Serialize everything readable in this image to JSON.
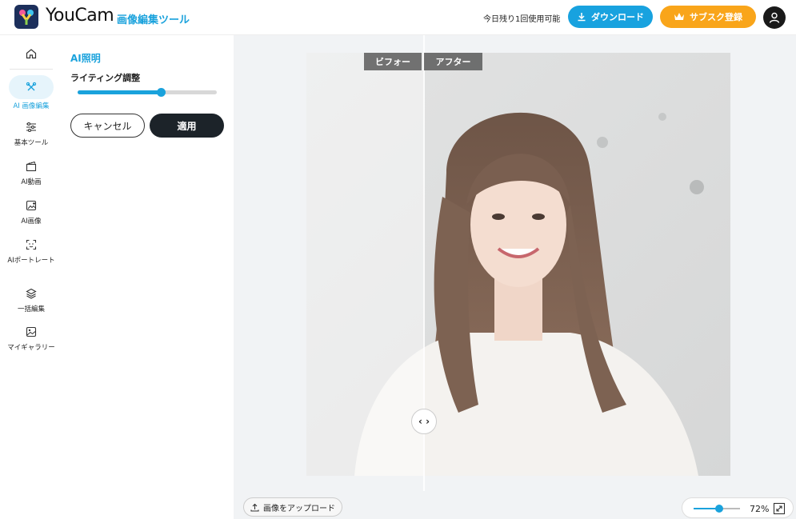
{
  "header": {
    "brand": "YouCam",
    "brand_sub": "画像編集ツール",
    "remaining_text": "今日残り1回使用可能",
    "download_label": "ダウンロード",
    "subscribe_label": "サブスク登録",
    "colors": {
      "accent": "#1aa2dc",
      "subscribe": "#f9a51a"
    }
  },
  "nav": {
    "items": [
      {
        "label": "",
        "icon": "home-icon"
      },
      {
        "label": "AI 画像編集",
        "icon": "magic-edit-icon",
        "active": true
      },
      {
        "label": "基本ツール",
        "icon": "sliders-icon"
      },
      {
        "label": "AI動画",
        "icon": "clapper-icon"
      },
      {
        "label": "AI画像",
        "icon": "image-plus-icon"
      },
      {
        "label": "AIポートレート",
        "icon": "face-scan-icon"
      },
      {
        "label": "一括編集",
        "icon": "layers-icon"
      },
      {
        "label": "マイギャラリー",
        "icon": "gallery-icon"
      }
    ]
  },
  "panel": {
    "title": "AI照明",
    "adjust_label": "ライティング調整",
    "slider_value": 0.6,
    "cancel_label": "キャンセル",
    "apply_label": "適用"
  },
  "canvas": {
    "before_label": "ビフォー",
    "after_label": "アフター",
    "upload_label": "画像をアップロード",
    "zoom_value": "72%",
    "zoom_slider": 0.55
  }
}
